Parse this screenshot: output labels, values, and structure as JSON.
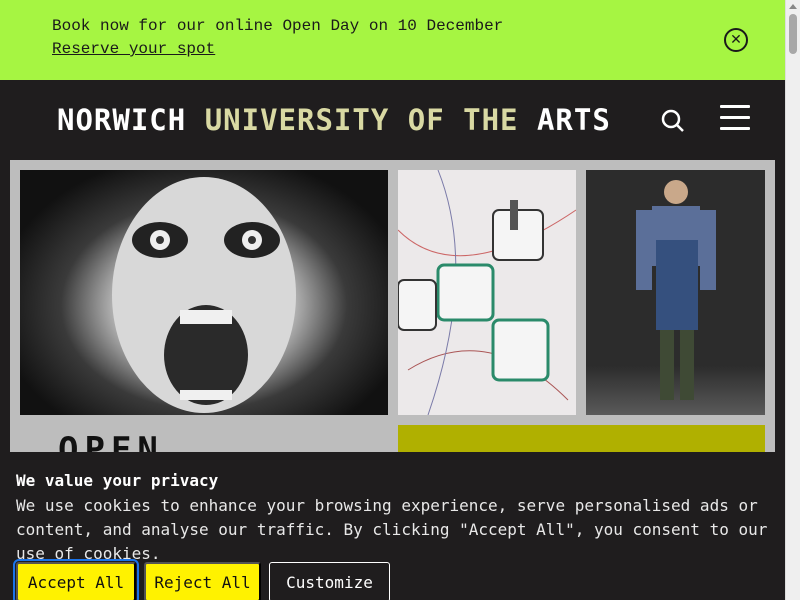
{
  "announcement": {
    "text": "Book now for our online Open Day on 10 December",
    "link": "Reserve your spot",
    "close_icon": "close-circle-icon"
  },
  "header": {
    "logo_word1": "NORWICH",
    "logo_word2": "UNIVERSITY OF THE",
    "logo_word3": "ARTS",
    "search_icon": "search-icon",
    "menu_icon": "hamburger-menu-icon"
  },
  "hero": {
    "open_text": "OPEN"
  },
  "cookie": {
    "title": "We value your privacy",
    "text": "We use cookies to enhance your browsing experience, serve personalised ads or content, and analyse our traffic. By clicking \"Accept All\", you consent to our use of cookies.",
    "accept_label": "Accept All",
    "reject_label": "Reject All",
    "customize_label": "Customize"
  },
  "colors": {
    "announcement_bg": "#a6f542",
    "header_bg": "#1f1d1e",
    "button_yellow": "#fff200",
    "logo_muted": "#d9d9a3"
  }
}
